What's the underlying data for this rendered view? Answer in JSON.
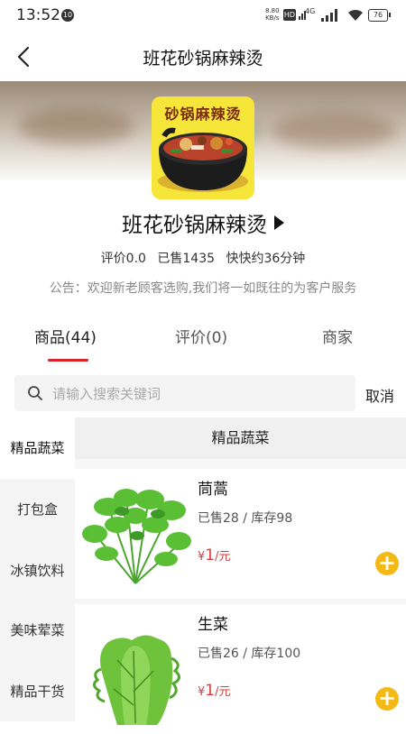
{
  "status_bar": {
    "time": "13:52",
    "notification_badge": "10",
    "network_speed_value": "8.80",
    "network_speed_unit": "KB/s",
    "hd_label": "HD",
    "net_type": "4G",
    "battery": "76"
  },
  "nav": {
    "title": "班花砂锅麻辣烫"
  },
  "shop": {
    "logo_text": "砂锅麻辣烫",
    "name": "班花砂锅麻辣烫",
    "rating": "评价0.0",
    "sold": "已售1435",
    "delivery": "快快约36分钟",
    "notice": "公告：欢迎新老顾客选购,我们将一如既往的为客户服务"
  },
  "tabs": [
    {
      "label": "商品(44)"
    },
    {
      "label": "评价(0)"
    },
    {
      "label": "商家"
    }
  ],
  "search": {
    "placeholder": "请输入搜索关键词",
    "cancel": "取消"
  },
  "sidebar": {
    "items": [
      {
        "label": "精品蔬菜"
      },
      {
        "label": "打包盒"
      },
      {
        "label": "冰镇饮料"
      },
      {
        "label": "美味荤菜"
      },
      {
        "label": "精品干货"
      }
    ]
  },
  "category_header": "精品蔬菜",
  "products": [
    {
      "name": "茼蒿",
      "stock": "已售28 / 库存98",
      "currency": "¥",
      "price": "1",
      "unit": "/元"
    },
    {
      "name": "生菜",
      "stock": "已售26 / 库存100",
      "currency": "¥",
      "price": "1",
      "unit": "/元"
    }
  ],
  "colors": {
    "accent_red": "#d8232a",
    "add_button": "#f5b915",
    "price": "#e03a3a"
  }
}
